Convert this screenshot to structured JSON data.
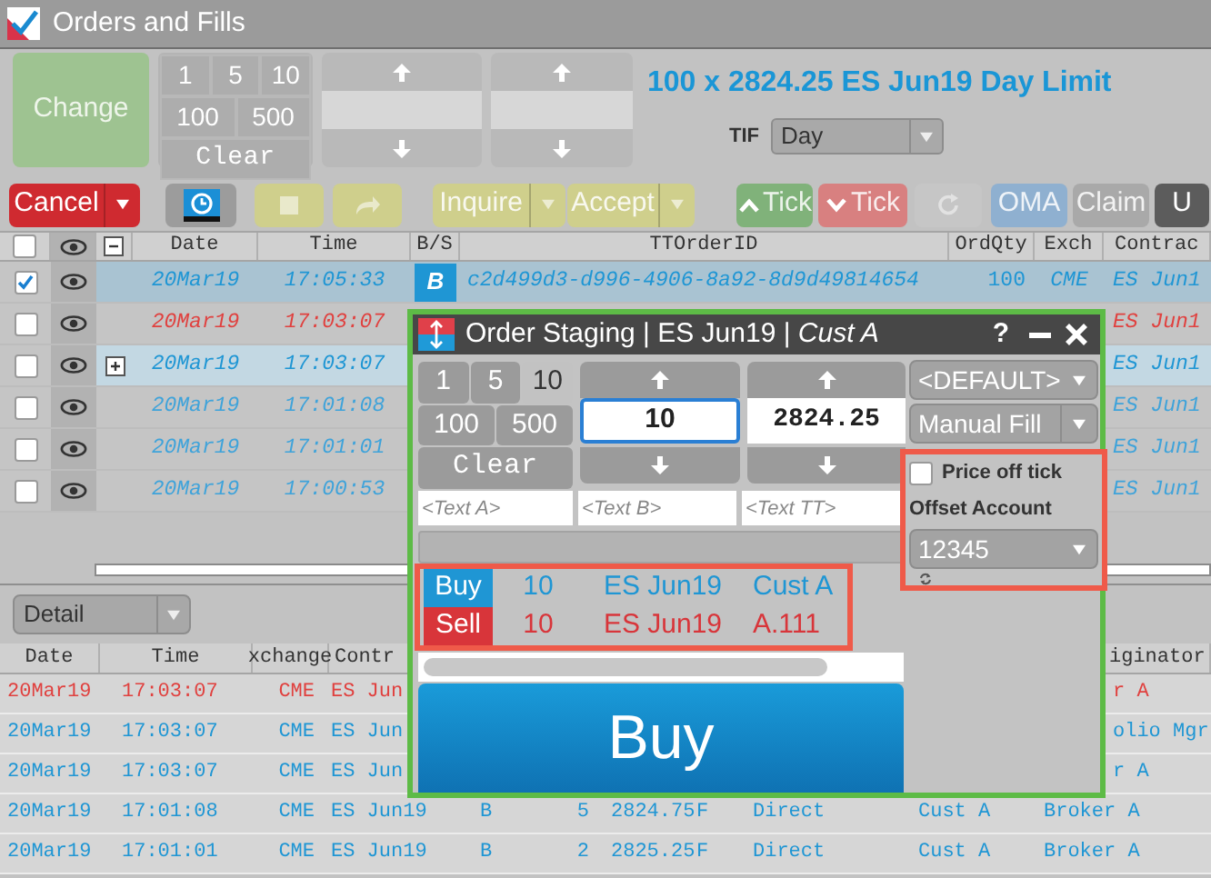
{
  "window": {
    "title": "Orders and Fills",
    "checked": true
  },
  "order_panel": {
    "change_button": "Change",
    "quantity_keys": [
      [
        {
          "label": "1"
        },
        {
          "label": "5"
        },
        {
          "label": "10"
        }
      ],
      [
        {
          "label": "100"
        },
        {
          "label": "500"
        }
      ],
      [
        {
          "label": "Clear"
        }
      ]
    ],
    "summary": "100 x 2824.25 ES Jun19 Day Limit",
    "tif": {
      "label": "TIF",
      "value": "Day"
    }
  },
  "toolbar": [
    {
      "kind": "split",
      "label": "Cancel",
      "color": "#cf2a30",
      "disabled": false
    },
    {
      "kind": "icon",
      "color": "#9c9c9c",
      "disabled": false
    },
    {
      "kind": "icon",
      "color": "#cfcf8c",
      "disabled": true
    },
    {
      "kind": "icon",
      "color": "#cfcf8c",
      "disabled": true
    },
    {
      "kind": "split",
      "label": "Inquire",
      "color": "#cfcf8c",
      "disabled": true
    },
    {
      "kind": "split",
      "label": "Accept",
      "color": "#cfcf8c",
      "disabled": true
    },
    {
      "kind": "icon-label",
      "label": "Tick",
      "color": "#80b27a",
      "disabled": true
    },
    {
      "kind": "icon-label",
      "label": "Tick",
      "color": "#d88080",
      "disabled": true
    },
    {
      "kind": "icon",
      "color": "#c6c6c6",
      "disabled": true
    },
    {
      "kind": "label",
      "label": "OMA",
      "color": "#8fb0d0",
      "disabled": true
    },
    {
      "kind": "label",
      "label": "Claim",
      "color": "#a9a9a9",
      "disabled": true
    },
    {
      "kind": "label",
      "label": "U",
      "color": "#5c5c5c",
      "disabled": false
    }
  ],
  "orders": {
    "header": {
      "checked": false,
      "expanded": true,
      "columns": [
        "Date",
        "Time",
        "B/S",
        "TTOrderID",
        "OrdQty",
        "Exch",
        "Contrac"
      ]
    },
    "rows": [
      {
        "highlighted": false,
        "checked": true,
        "selected": true,
        "color": "#1f96d4",
        "date": "20Mar19",
        "time": "17:05:33",
        "side": "B",
        "order_id": "c2d499d3-d996-4906-8a92-8d9d49814654",
        "qty": "100",
        "exchange": "CME",
        "contract": "ES Jun1"
      },
      {
        "highlighted": false,
        "checked": false,
        "selected": false,
        "color": "#e0413f",
        "date": "20Mar19",
        "time": "17:03:07",
        "contract": "ES Jun1"
      },
      {
        "highlighted": true,
        "checked": false,
        "selected": false,
        "expanded": false,
        "color": "#1f96d4",
        "date": "20Mar19",
        "time": "17:03:07",
        "contract": "ES Jun1"
      },
      {
        "highlighted": false,
        "checked": false,
        "selected": false,
        "color": "#3fa3da",
        "date": "20Mar19",
        "time": "17:01:08",
        "contract": "ES Jun1"
      },
      {
        "highlighted": false,
        "checked": false,
        "selected": false,
        "color": "#3fa3da",
        "date": "20Mar19",
        "time": "17:01:01",
        "contract": "ES Jun1"
      },
      {
        "highlighted": false,
        "checked": false,
        "selected": false,
        "color": "#3fa3da",
        "date": "20Mar19",
        "time": "17:00:53",
        "contract": "ES Jun1"
      }
    ]
  },
  "view_select": {
    "value": "Detail"
  },
  "fills": {
    "header": {
      "date": "Date",
      "time": "Time",
      "exchange": "xchange",
      "contract": "Contr",
      "originator": "iginator"
    },
    "rows": [
      {
        "kind": "partial",
        "color": "#e0413f",
        "date": "20Mar19",
        "time": "17:03:07",
        "exchange": "CME",
        "contract": "ES Jun",
        "originator": "r A"
      },
      {
        "kind": "partial",
        "color": "#1f96d4",
        "date": "20Mar19",
        "time": "17:03:07",
        "exchange": "CME",
        "contract": "ES Jun",
        "originator": "olio Mgr"
      },
      {
        "kind": "partial",
        "color": "#1f96d4",
        "date": "20Mar19",
        "time": "17:03:07",
        "exchange": "CME",
        "contract": "ES Jun",
        "originator": "r A"
      },
      {
        "kind": "full",
        "color": "#1f96d4",
        "date": "20Mar19",
        "time": "17:01:08",
        "exchange": "CME",
        "contract": "ES Jun19",
        "side": "B",
        "qty": "5",
        "price": "2824.75",
        "flag": "F",
        "route": "Direct",
        "account": "Cust A",
        "originator": "Broker A"
      },
      {
        "kind": "full",
        "color": "#1f96d4",
        "date": "20Mar19",
        "time": "17:01:01",
        "exchange": "CME",
        "contract": "ES Jun19",
        "side": "B",
        "qty": "2",
        "price": "2825.25",
        "flag": "F",
        "route": "Direct",
        "account": "Cust A",
        "originator": "Broker A"
      }
    ]
  },
  "staging": {
    "title": "Order Staging | ES Jun19 | *Cust A*",
    "help": "?",
    "quantity_keys": [
      [
        {
          "label": "1",
          "selected": false
        },
        {
          "label": "5",
          "selected": false
        },
        {
          "label": "10",
          "selected": true
        }
      ],
      [
        {
          "label": "100",
          "selected": false
        },
        {
          "label": "500",
          "selected": false
        }
      ],
      [
        {
          "label": "Clear",
          "selected": false
        }
      ]
    ],
    "quantity": "10",
    "price": "2824.25",
    "text_fields": [
      {
        "placeholder": "<Text A>"
      },
      {
        "placeholder": "<Text B>"
      },
      {
        "placeholder": "<Text TT>"
      }
    ],
    "order_profile": "<DEFAULT>",
    "fill_type": "Manual Fill",
    "price_off_tick": {
      "label": "Price off tick",
      "checked": false
    },
    "offset_account": {
      "label": "Offset Account",
      "value": "12345"
    },
    "preview": [
      {
        "side": "Buy",
        "qty": "10",
        "contract": "ES Jun19",
        "account": "Cust A",
        "color": "#1f96d4"
      },
      {
        "side": "Sell",
        "qty": "10",
        "contract": "ES Jun19",
        "account": "A.111",
        "color": "#d8353a"
      }
    ],
    "submit": "Buy"
  }
}
